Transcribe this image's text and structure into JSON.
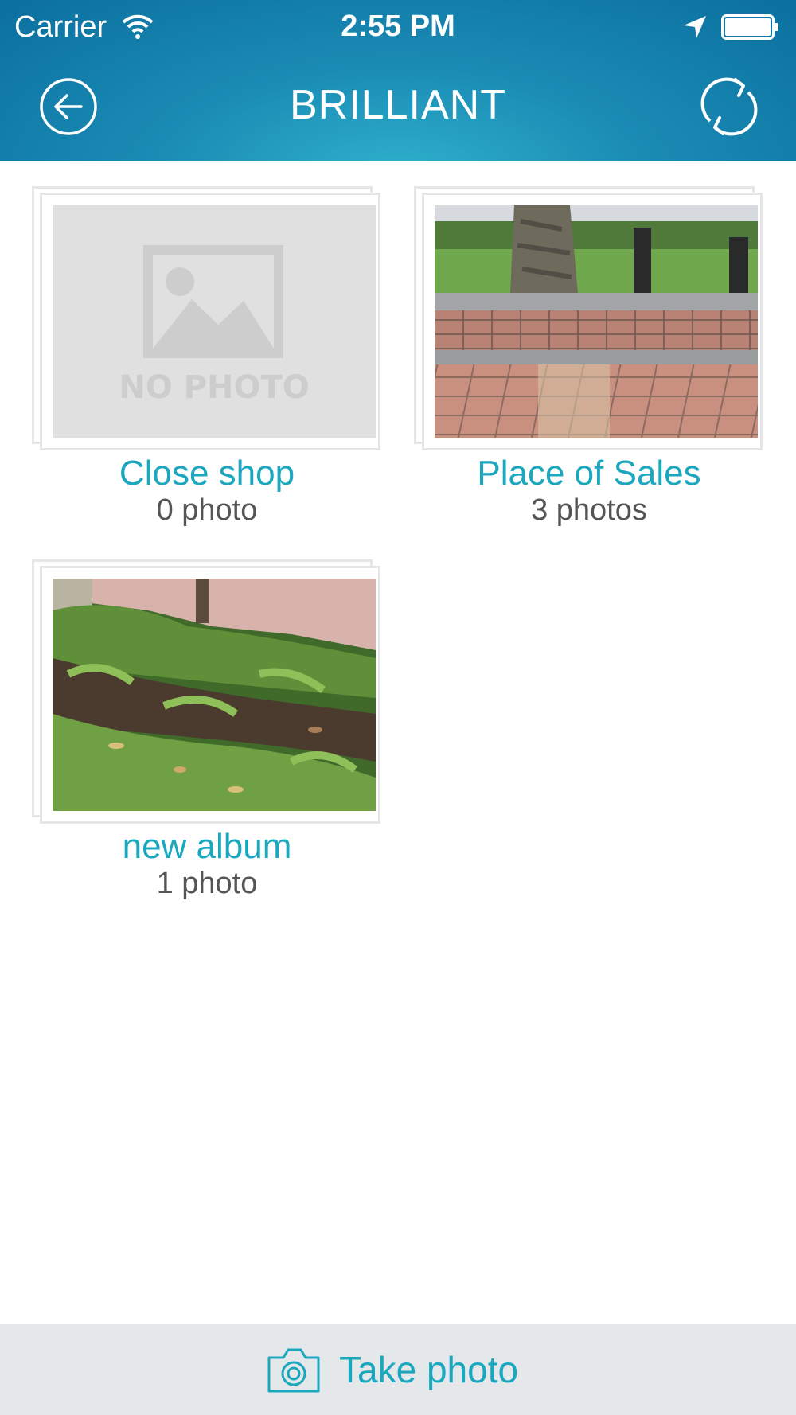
{
  "status_bar": {
    "carrier": "Carrier",
    "time": "2:55 PM"
  },
  "nav": {
    "title": "BRILLIANT",
    "back_icon": "back-arrow-circle-icon",
    "refresh_icon": "refresh-icon"
  },
  "albums": [
    {
      "name": "Close shop",
      "count": "0 photo",
      "thumbnail": "no-photo-placeholder",
      "placeholder_text": "NO PHOTO"
    },
    {
      "name": "Place of Sales",
      "count": "3 photos",
      "thumbnail": "paved-sidewalk-photo"
    },
    {
      "name": "new album",
      "count": "1 photo",
      "thumbnail": "garden-shrubs-photo"
    }
  ],
  "footer": {
    "label": "Take photo",
    "icon": "camera-icon"
  },
  "colors": {
    "header": "#1a8bb4",
    "accent": "#1ba8bf",
    "footer_bg": "#e5e8ea"
  }
}
